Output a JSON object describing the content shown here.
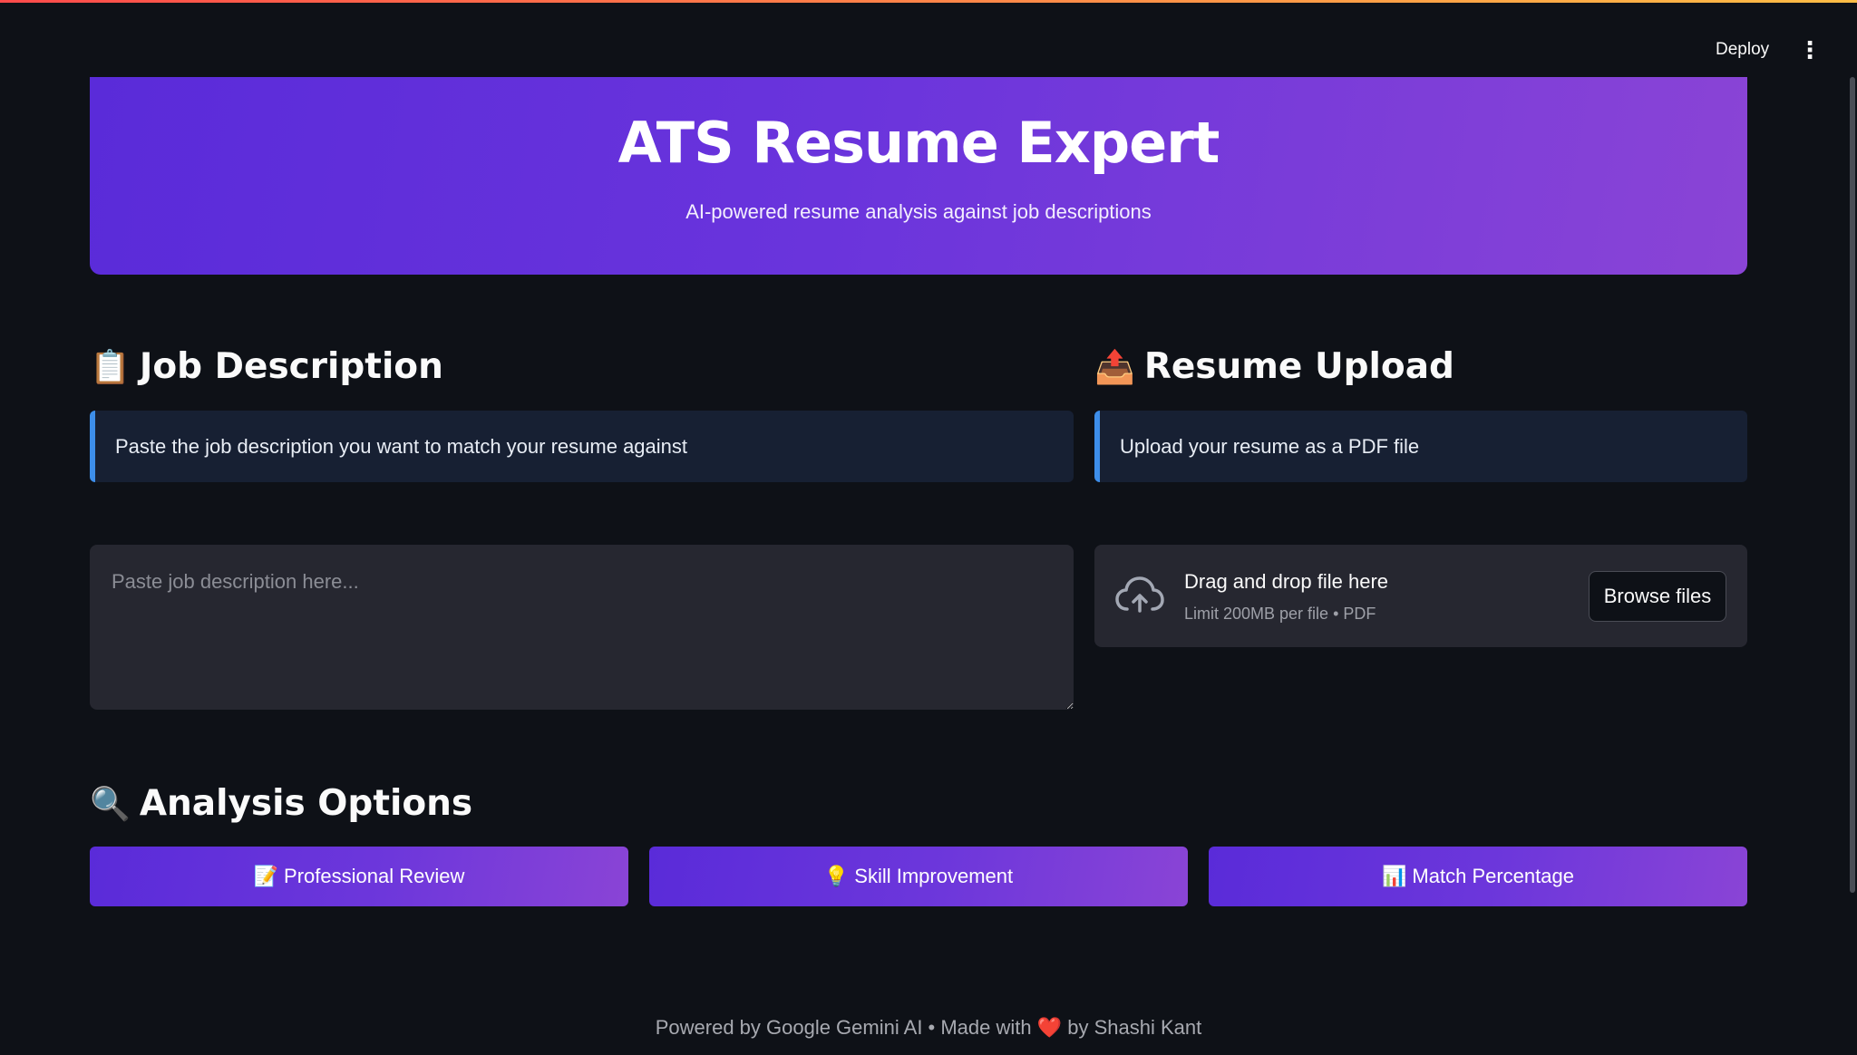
{
  "header": {
    "deploy_label": "Deploy",
    "menu_icon": "⋮"
  },
  "hero": {
    "title": "ATS Resume Expert",
    "subtitle": "AI-powered resume analysis against job descriptions"
  },
  "job_description": {
    "icon": "📋",
    "title": "Job Description",
    "info": "Paste the job description you want to match your resume against",
    "placeholder": "Paste job description here...",
    "value": ""
  },
  "resume_upload": {
    "icon": "📤",
    "title": "Resume Upload",
    "info": "Upload your resume as a PDF file",
    "dropzone_label": "Drag and drop file here",
    "dropzone_limit": "Limit 200MB per file • PDF",
    "browse_label": "Browse files"
  },
  "analysis": {
    "icon": "🔍",
    "title": "Analysis Options",
    "buttons": [
      {
        "icon": "📝",
        "label": "Professional Review"
      },
      {
        "icon": "💡",
        "label": "Skill Improvement"
      },
      {
        "icon": "📊",
        "label": "Match Percentage"
      }
    ]
  },
  "footer": {
    "prefix": "Powered by Google Gemini AI • Made with",
    "heart": "❤️",
    "suffix": "by Shashi Kant"
  },
  "colors": {
    "background": "#0e1117",
    "accent_gradient_start": "#5a2bd9",
    "accent_gradient_end": "#8a44d6",
    "info_border": "#3d8eea",
    "input_bg": "#262730"
  }
}
